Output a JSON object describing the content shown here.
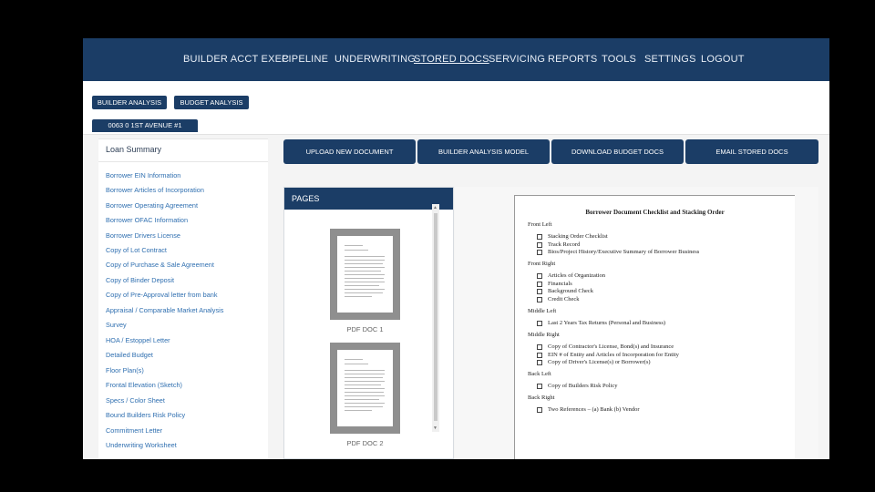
{
  "nav": {
    "items": [
      "BUILDER ACCT EXEC",
      "PIPELINE",
      "UNDERWRITING",
      "STORED DOCS",
      "SERVICING",
      "REPORTS",
      "TOOLS",
      "SETTINGS",
      "LOGOUT"
    ],
    "active": "STORED DOCS"
  },
  "subnav": {
    "builder_analysis": "BUILDER ANALYSIS",
    "budget_analysis": "BUDGET ANALYSIS",
    "address": "0063 0 1ST AVENUE #1"
  },
  "sidebar": {
    "title": "Loan Summary",
    "items": [
      "Borrower EIN Information",
      "Borrower Articles of Incorporation",
      "Borrower Operating Agreement",
      "Borrower OFAC Information",
      "Borrower Drivers License",
      "Copy of Lot Contract",
      "Copy of Purchase & Sale Agreement",
      "Copy of Binder Deposit",
      "Copy of Pre-Approval letter from bank",
      "Appraisal / Comparable Market Analysis",
      "Survey",
      "HOA / Estoppel Letter",
      "Detailed Budget",
      "Floor Plan(s)",
      "Frontal Elevation (Sketch)",
      "Specs / Color Sheet",
      "Bound Builders Risk Policy",
      "Commitment Letter",
      "Underwriting Worksheet"
    ]
  },
  "actions": {
    "upload": "UPLOAD NEW DOCUMENT",
    "model": "BUILDER ANALYSIS MODEL",
    "download": "DOWNLOAD BUDGET DOCS",
    "email": "EMAIL STORED DOCS"
  },
  "pages": {
    "header": "PAGES",
    "docs": [
      "PDF DOC 1",
      "PDF DOC 2"
    ]
  },
  "document": {
    "title": "Borrower Document Checklist and Stacking Order",
    "sections": [
      {
        "name": "Front Left",
        "items": [
          "Stacking Order Checklist",
          "Track Record",
          "Bios/Project History/Executive Summary of Borrower Business"
        ]
      },
      {
        "name": "Front Right",
        "items": [
          "Articles of Organization",
          "Financials",
          "Background Check",
          "Credit Check"
        ]
      },
      {
        "name": "Middle Left",
        "items": [
          "Last 2 Years Tax Returns (Personal and Business)"
        ]
      },
      {
        "name": "Middle Right",
        "items": [
          "Copy of Contractor's License, Bond(s) and Insurance",
          "EIN # of Entity and Articles of Incorporation for Entity",
          "Copy of Driver's License(s) or Borrower(s)"
        ]
      },
      {
        "name": "Back Left",
        "items": [
          "Copy of Builders Risk Policy"
        ]
      },
      {
        "name": "Back Right",
        "items": [
          "Two References – (a) Bank (b) Vendor"
        ]
      }
    ]
  },
  "colors": {
    "navy": "#1b3d66",
    "link": "#2f6fb0"
  }
}
